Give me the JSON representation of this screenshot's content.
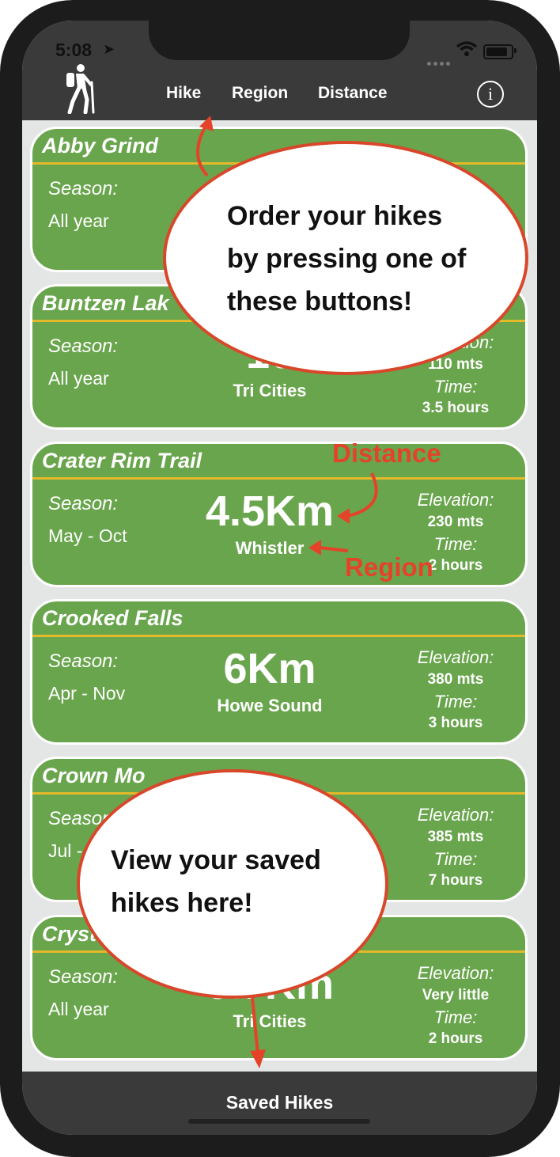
{
  "status_bar": {
    "time": "5:08"
  },
  "nav": {
    "buttons": [
      "Hike",
      "Region",
      "Distance"
    ],
    "info_icon": "info-icon",
    "logo_icon": "hiker-icon"
  },
  "labels": {
    "season": "Season:",
    "elevation": "Elevation:",
    "time": "Time:"
  },
  "hikes": [
    {
      "title": "Abby Grind",
      "season": "All year",
      "distance": "",
      "region": "",
      "elevation": "",
      "time": ""
    },
    {
      "title": "Buntzen Lak",
      "season": "All year",
      "distance": "10",
      "region": "Tri Cities",
      "elevation": "110 mts",
      "time": "3.5 hours"
    },
    {
      "title": "Crater Rim Trail",
      "season": "May - Oct",
      "distance": "4.5Km",
      "region": "Whistler",
      "elevation": "230 mts",
      "time": "2 hours"
    },
    {
      "title": "Crooked Falls",
      "season": "Apr - Nov",
      "distance": "6Km",
      "region": "Howe Sound",
      "elevation": "380 mts",
      "time": "3 hours"
    },
    {
      "title": "Crown Mo",
      "season": "Jul -",
      "distance": "",
      "region": "",
      "elevation": "385 mts",
      "time": "7 hours"
    },
    {
      "title": "Cryst",
      "season": "All year",
      "distance": "6.7Km",
      "region": "Tri Cities",
      "elevation": "Very little",
      "time": "2 hours"
    }
  ],
  "tab_bar": {
    "saved_label": "Saved Hikes"
  },
  "annotations": {
    "order_bubble": [
      "Order your hikes",
      "by pressing one of",
      "these buttons!"
    ],
    "saved_bubble": [
      "View your saved",
      "hikes here!"
    ],
    "distance_label": "Distance",
    "region_label": "Region",
    "accent_color": "#e4432a"
  },
  "colors": {
    "card_green": "#69a54c",
    "divider_gold": "#e4b92a",
    "bar_dark": "#3a3a3a"
  }
}
